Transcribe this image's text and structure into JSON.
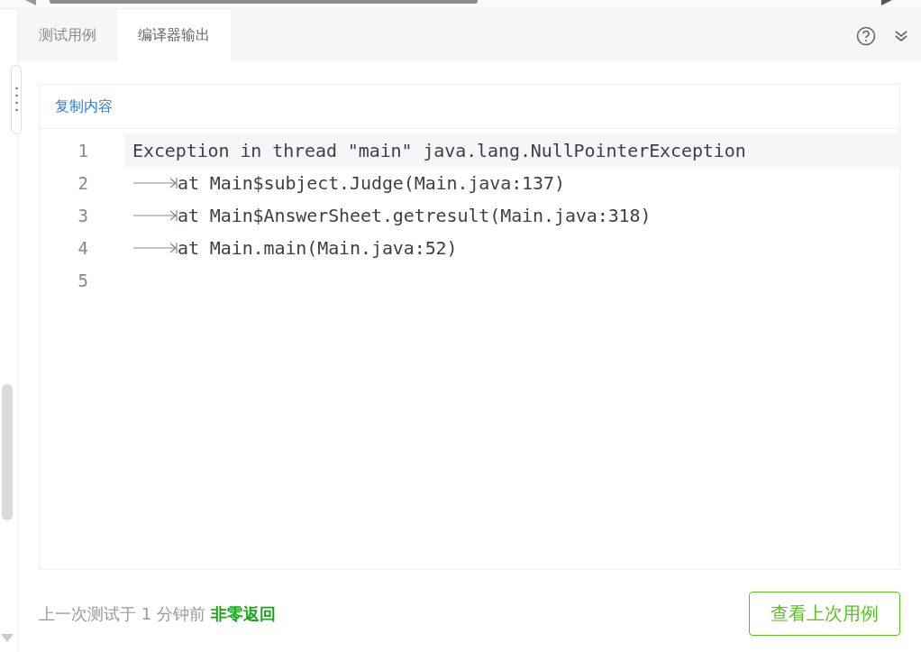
{
  "tabs": [
    {
      "label": "测试用例",
      "selected": false
    },
    {
      "label": "编译器输出",
      "selected": true
    }
  ],
  "copy_link": "复制内容",
  "lines": [
    {
      "number": "1",
      "text": "Exception in thread \"main\" java.lang.NullPointerException",
      "indented": false,
      "current": true
    },
    {
      "number": "2",
      "text": "at Main$subject.Judge(Main.java:137)",
      "indented": true,
      "current": false
    },
    {
      "number": "3",
      "text": "at Main$AnswerSheet.getresult(Main.java:318)",
      "indented": true,
      "current": false
    },
    {
      "number": "4",
      "text": "at Main.main(Main.java:52)",
      "indented": true,
      "current": false
    },
    {
      "number": "5",
      "indented": false,
      "current": false
    }
  ],
  "status": "上一次测试于 1 分钟前 **非零返回**",
  "button": "查看上次用例"
}
